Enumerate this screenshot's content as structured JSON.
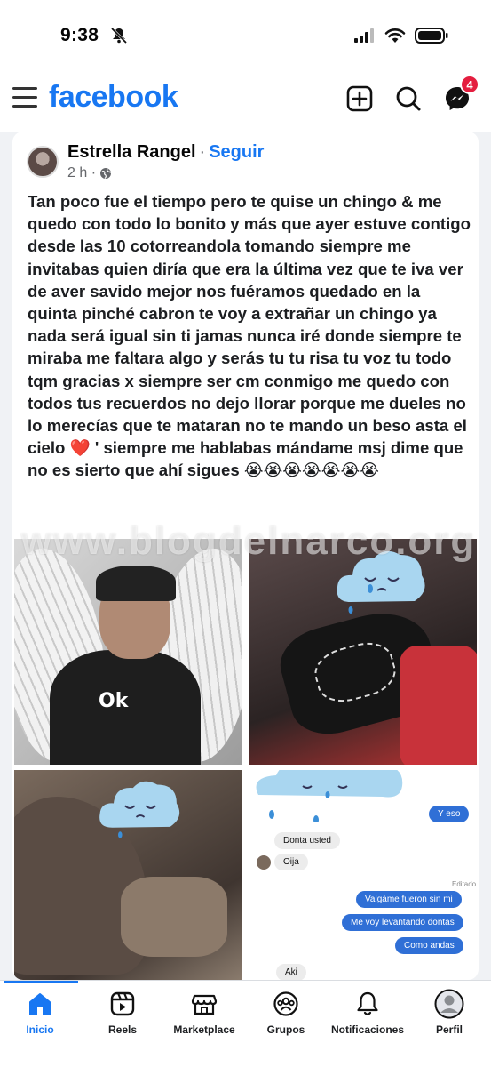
{
  "status_bar": {
    "time": "9:38",
    "icons": [
      "bell-slash-icon",
      "signal-icon",
      "wifi-icon",
      "battery-icon"
    ]
  },
  "header": {
    "logo": "facebook",
    "icons": [
      "menu-icon",
      "plus-square-icon",
      "search-icon",
      "messenger-icon"
    ],
    "messenger_badge": "4"
  },
  "post": {
    "author": "Estrella Rangel",
    "separator": "·",
    "follow_label": "Seguir",
    "time": "2 h ·",
    "privacy_icon": "globe-icon",
    "text": "Tan poco fue el tiempo pero te quise un chingo & me quedo con todo lo bonito y más que ayer estuve contigo desde las 10 cotorreandola tomando siempre me invitabas quien diría que era la última vez que te iva ver de aver savido mejor nos fuéramos quedado en la quinta pinché cabron te voy a extrañar un chingo ya nada será igual sin ti jamas nunca iré donde siempre te miraba me faltara algo y serás tu tu risa tu voz tu todo tqm gracias x siempre ser cm conmigo me quedo con todos tus recuerdos no dejo llorar porque me dueles no lo merecías que te mataran no te mando un beso asta el cielo ❤️ ' siempre me hablabas mándame msj dime que no es sierto que ahí sigues 😭😭😭😭😭😭😭",
    "watermark": "www.blogdelnarco.org",
    "photo1_shirt_text": "Ok",
    "chat": {
      "msg1": "Y eso",
      "msg2": "Donta usted",
      "msg3": "Oija",
      "edited": "Editado",
      "msg4": "Valgáme fueron sin mi",
      "msg5": "Me voy levantando dontas",
      "msg6": "Como andas",
      "msg7": "Aki"
    }
  },
  "bottom_nav": [
    {
      "label": "Inicio",
      "icon": "home-icon",
      "active": true
    },
    {
      "label": "Reels",
      "icon": "reels-icon",
      "active": false
    },
    {
      "label": "Marketplace",
      "icon": "marketplace-icon",
      "active": false
    },
    {
      "label": "Grupos",
      "icon": "groups-icon",
      "active": false
    },
    {
      "label": "Notificaciones",
      "icon": "bell-icon",
      "active": false
    },
    {
      "label": "Perfil",
      "icon": "profile-icon",
      "active": false
    }
  ],
  "colors": {
    "brand": "#1877f2",
    "badge": "#e41e3f",
    "chat_out": "#2f6fd6"
  }
}
